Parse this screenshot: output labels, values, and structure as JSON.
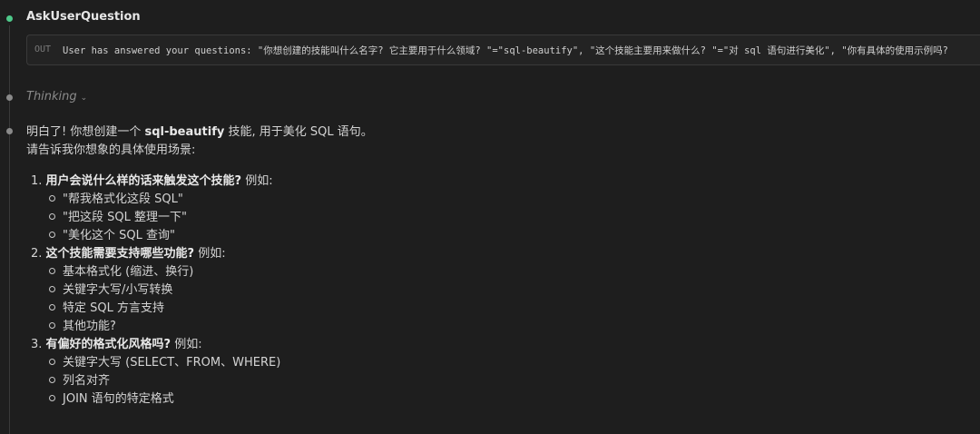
{
  "tool_call": {
    "title": "AskUserQuestion",
    "output_label": "OUT",
    "output_text": "User has answered your questions: \"你想创建的技能叫什么名字? 它主要用于什么领域? \"=\"sql-beautify\", \"这个技能主要用来做什么? \"=\"对 sql 语句进行美化\", \"你有具体的使用示例吗?"
  },
  "thinking": {
    "label": "Thinking",
    "chevron": "⌄"
  },
  "message": {
    "intro_prefix": "明白了! 你想创建一个 ",
    "intro_skill": "sql-beautify",
    "intro_suffix": " 技能, 用于美化 SQL 语句。",
    "ask": "请告诉我你想象的具体使用场景:",
    "questions": [
      {
        "number": "1.",
        "title": "用户会说什么样的话来触发这个技能?",
        "hint": " 例如:",
        "options": [
          "\"帮我格式化这段 SQL\"",
          "\"把这段 SQL 整理一下\"",
          "\"美化这个 SQL 查询\""
        ]
      },
      {
        "number": "2.",
        "title": "这个技能需要支持哪些功能?",
        "hint": " 例如:",
        "options": [
          "基本格式化 (缩进、换行)",
          "关键字大写/小写转换",
          "特定 SQL 方言支持",
          "其他功能?"
        ]
      },
      {
        "number": "3.",
        "title": "有偏好的格式化风格吗?",
        "hint": " 例如:",
        "options": [
          "关键字大写 (SELECT、FROM、WHERE)",
          "列名对齐",
          "JOIN 语句的特定格式"
        ]
      }
    ]
  },
  "colors": {
    "background": "#1e1e1e",
    "status_ok": "#4ec98a",
    "status_neutral": "#8a8a8a"
  }
}
